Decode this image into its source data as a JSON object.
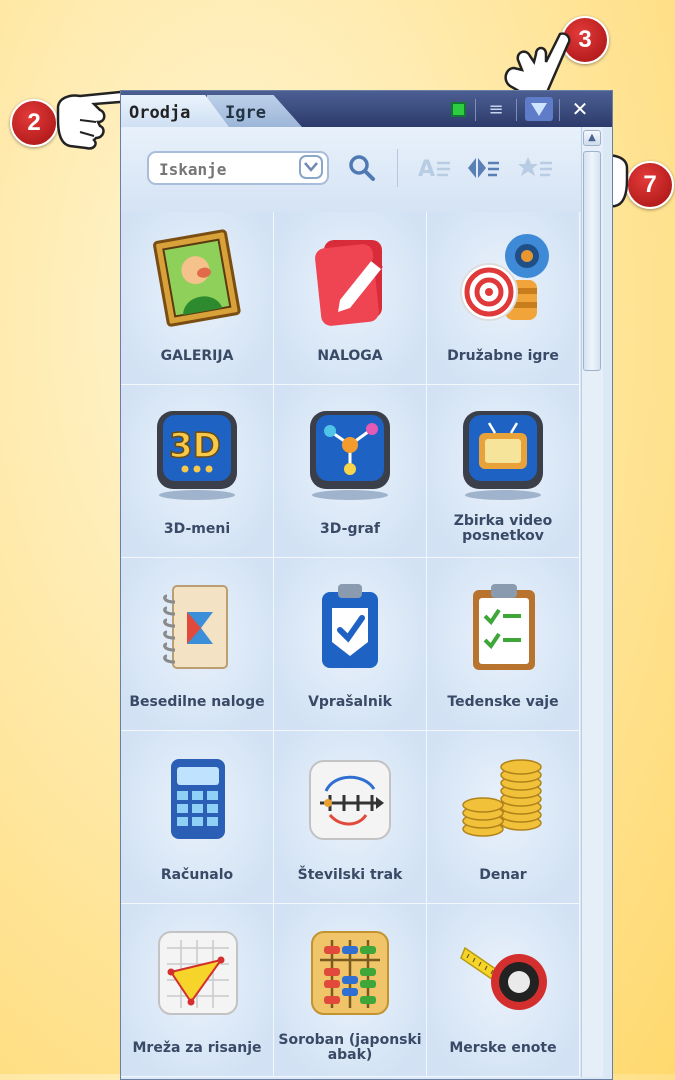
{
  "callouts": [
    {
      "number": "2"
    },
    {
      "number": "3"
    },
    {
      "number": "7"
    }
  ],
  "window": {
    "tabs": [
      {
        "label": "Orodja",
        "active": true
      },
      {
        "label": "Igre",
        "active": false
      }
    ],
    "controls": {
      "status_color": "#2ecc40",
      "list": "list-icon",
      "menu": "triangle-down-icon",
      "close": "close-icon"
    }
  },
  "toolbar": {
    "search_placeholder": "Iskanje",
    "icons": [
      "search-icon",
      "alphabetical-sort-icon",
      "arrange-icon",
      "favorites-sort-icon"
    ]
  },
  "grid": {
    "items": [
      {
        "label": "GALERIJA",
        "icon": "gallery-icon"
      },
      {
        "label": "NALOGA",
        "icon": "task-icon"
      },
      {
        "label": "Družabne igre",
        "icon": "party-games-icon"
      },
      {
        "label": "3D-meni",
        "icon": "3d-menu-icon"
      },
      {
        "label": "3D-graf",
        "icon": "3d-graph-icon"
      },
      {
        "label": "Zbirka video posnetkov",
        "icon": "video-collection-icon"
      },
      {
        "label": "Besedilne naloge",
        "icon": "word-problems-icon"
      },
      {
        "label": "Vprašalnik",
        "icon": "questionnaire-icon"
      },
      {
        "label": "Tedenske vaje",
        "icon": "weekly-exercises-icon"
      },
      {
        "label": "Računalo",
        "icon": "calculator-icon"
      },
      {
        "label": "Številski trak",
        "icon": "number-line-icon"
      },
      {
        "label": "Denar",
        "icon": "money-icon"
      },
      {
        "label": "Mreža za risanje",
        "icon": "drawing-grid-icon"
      },
      {
        "label": "Soroban (japonski abak)",
        "icon": "abacus-icon"
      },
      {
        "label": "Merske enote",
        "icon": "measuring-tape-icon"
      }
    ]
  }
}
